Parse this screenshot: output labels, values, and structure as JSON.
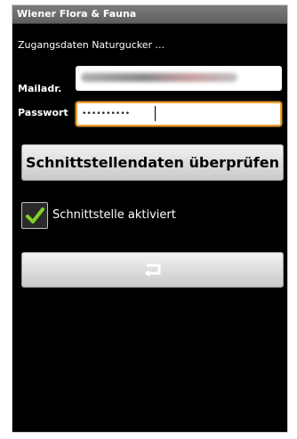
{
  "app": {
    "title": "Wiener Flora & Fauna"
  },
  "form": {
    "subtitle": "Zugangsdaten Naturgucker ...",
    "mail_label": "Mailadr.",
    "mail_value": "(redacted)",
    "password_label": "Passwort",
    "password_value": "••••••••••"
  },
  "actions": {
    "check_button_label": "Schnittstellendaten überprüfen",
    "checkbox_label": "Schnittstelle aktiviert",
    "checkbox_checked": true,
    "back_icon": "return-arrow-icon"
  },
  "colors": {
    "focus_border": "#f0a030",
    "check_mark": "#7ed321"
  }
}
